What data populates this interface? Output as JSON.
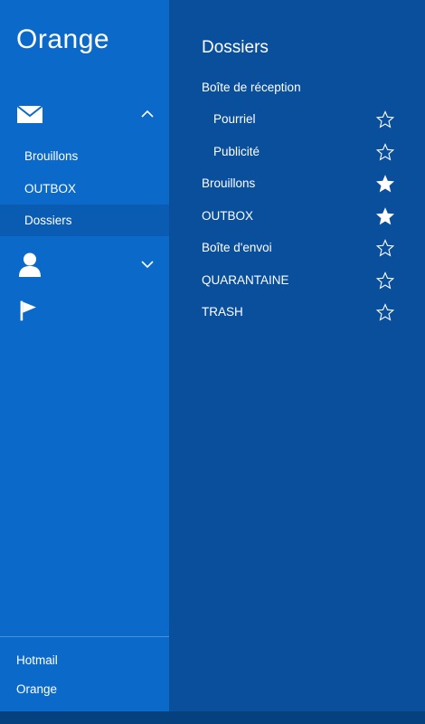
{
  "app": {
    "title": "Orange"
  },
  "nav": {
    "mail_section": {
      "icon": "mail-icon",
      "chevron": "chevron-up-icon",
      "items": [
        {
          "label": "Brouillons",
          "selected": false
        },
        {
          "label": "OUTBOX",
          "selected": false
        },
        {
          "label": "Dossiers",
          "selected": true
        }
      ]
    },
    "people_section": {
      "icon": "person-icon",
      "chevron": "chevron-down-icon"
    },
    "flag_section": {
      "icon": "flag-icon"
    },
    "accounts": [
      {
        "label": "Hotmail"
      },
      {
        "label": "Orange"
      }
    ]
  },
  "folders": {
    "title": "Dossiers",
    "items": [
      {
        "label": "Boîte de réception",
        "indent": 0,
        "star": null
      },
      {
        "label": "Pourriel",
        "indent": 1,
        "star": "outline"
      },
      {
        "label": "Publicité",
        "indent": 1,
        "star": "outline"
      },
      {
        "label": "Brouillons",
        "indent": 0,
        "star": "filled"
      },
      {
        "label": "OUTBOX",
        "indent": 0,
        "star": "filled"
      },
      {
        "label": "Boîte d'envoi",
        "indent": 0,
        "star": "outline"
      },
      {
        "label": "QUARANTAINE",
        "indent": 0,
        "star": "outline"
      },
      {
        "label": "TRASH",
        "indent": 0,
        "star": "outline"
      }
    ]
  },
  "colors": {
    "nav_bg": "#0b6ac9",
    "nav_selected_bg": "#0a5cb3",
    "folders_bg": "#0a4f9c",
    "text": "#ffffff"
  }
}
